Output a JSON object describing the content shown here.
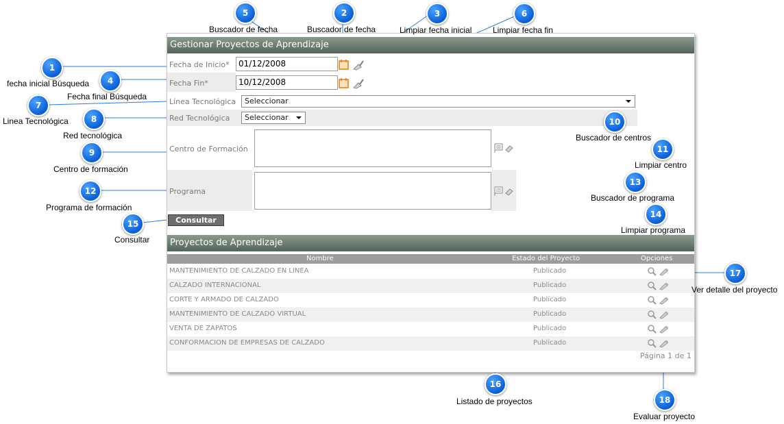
{
  "form": {
    "title": "Gestionar Proyectos de Aprendizaje",
    "fecha_inicio_label": "Fecha de Inicio*",
    "fecha_inicio_value": "01/12/2008",
    "fecha_fin_label": "Fecha Fin*",
    "fecha_fin_value": "10/12/2008",
    "linea_label": "Línea Tecnológica",
    "linea_value": "Seleccionar",
    "red_label": "Red Tecnológica",
    "red_value": "Seleccionar",
    "centro_label": "Centro de Formación",
    "programa_label": "Programa",
    "consultar_label": "Consultar"
  },
  "list": {
    "title": "Proyectos de Aprendizaje",
    "columns": [
      "Nombre",
      "Estado del Proyecto",
      "Opciones"
    ],
    "rows": [
      {
        "nombre": "MANTENIMIENTO DE CALZADO EN LINEA",
        "estado": "Publicado"
      },
      {
        "nombre": "CALZADO INTERNACIONAL",
        "estado": "Publicado"
      },
      {
        "nombre": "CORTE Y ARMADO DE CALZADO",
        "estado": "Publicado"
      },
      {
        "nombre": "MANTENIMIENTO DE CALZADO VIRTUAL",
        "estado": "Publicado"
      },
      {
        "nombre": "VENTA DE ZAPATOS",
        "estado": "Publicado"
      },
      {
        "nombre": "CONFORMACION DE EMPRESAS DE CALZADO",
        "estado": "Publicado"
      }
    ],
    "pagination": "Página 1 de 1"
  },
  "annotations": [
    {
      "num": "1",
      "caption": "fecha inicial Búsqueda"
    },
    {
      "num": "2",
      "caption": "Buscador de fecha"
    },
    {
      "num": "3",
      "caption": "Limpiar fecha inicial"
    },
    {
      "num": "4",
      "caption": "Fecha final Búsqueda"
    },
    {
      "num": "5",
      "caption": "Buscador de fecha"
    },
    {
      "num": "6",
      "caption": "Limpiar fecha fin"
    },
    {
      "num": "7",
      "caption": "Linea Tecnológica"
    },
    {
      "num": "8",
      "caption": "Red tecnológica"
    },
    {
      "num": "9",
      "caption": "Centro de formación"
    },
    {
      "num": "10",
      "caption": "Buscador de centros"
    },
    {
      "num": "11",
      "caption": "Limpiar centro"
    },
    {
      "num": "12",
      "caption": "Programa de formación"
    },
    {
      "num": "13",
      "caption": "Buscador de programa"
    },
    {
      "num": "14",
      "caption": "Limpiar programa"
    },
    {
      "num": "15",
      "caption": "Consultar"
    },
    {
      "num": "16",
      "caption": "Listado de proyectos"
    },
    {
      "num": "17",
      "caption": "Ver detalle del proyecto"
    },
    {
      "num": "18",
      "caption": "Evaluar proyecto"
    }
  ],
  "icons": {
    "calendar": "calendar-icon",
    "clear": "broom-icon",
    "search": "magnifier-icon",
    "edit": "pencil-icon",
    "lookup": "list-search-icon"
  },
  "colors": {
    "header": "#52645a",
    "badge": "#0a5fd8",
    "leader": "#2a7de1"
  }
}
